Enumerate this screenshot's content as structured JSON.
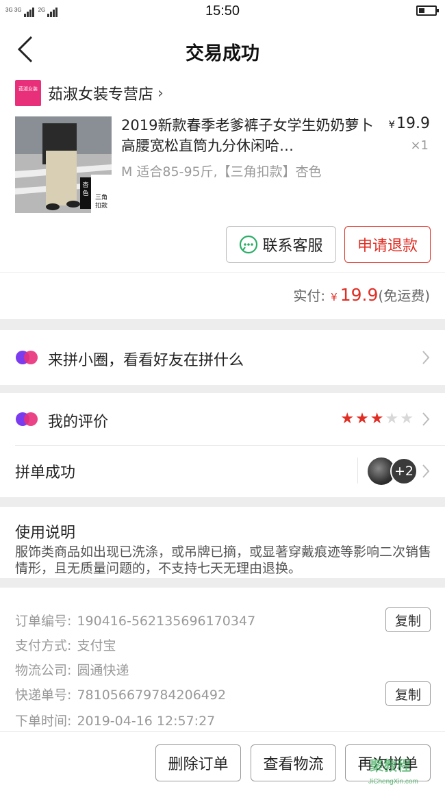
{
  "status_bar": {
    "time": "15:50",
    "signal_1": "3G 3G",
    "signal_2": "2G"
  },
  "header": {
    "title": "交易成功"
  },
  "order": {
    "shop": {
      "logo_text": "茹淑女装",
      "name": "茹淑女装专营店",
      "arrow": "›"
    },
    "product": {
      "image_tag_black": "杏色",
      "image_tag_white": "三角扣款",
      "title": "2019新款春季老爹裤子女学生奶奶萝卜高腰宽松直筒九分休闲哈…",
      "spec": "M 适合85-95斤,【三角扣款】杏色",
      "price_symbol": "¥",
      "price": "19.9",
      "quantity": "×1"
    },
    "buttons": {
      "contact_service": "联系客服",
      "request_refund": "申请退款"
    },
    "payment": {
      "label": "实付:",
      "symbol": "¥",
      "amount": "19.9",
      "note": "(免运费)"
    }
  },
  "circle": {
    "text": "来拼小圈，看看好友在拼什么"
  },
  "review": {
    "label": "我的评价",
    "rating": 3,
    "max_rating": 5
  },
  "group": {
    "label": "拼单成功",
    "more_count": "+2"
  },
  "usage": {
    "title": "使用说明",
    "body": "服饰类商品如出现已洗涤，或吊牌已摘，或显著穿戴痕迹等影响二次销售情形，且无质量问题的，不支持七天无理由退换。"
  },
  "info": {
    "order_no_label": "订单编号:",
    "order_no": "190416-562135696170347",
    "pay_method_label": "支付方式:",
    "pay_method": "支付宝",
    "logistics_label": "物流公司:",
    "logistics": "圆通快递",
    "tracking_label": "快递单号:",
    "tracking_no": "781056679784206492",
    "order_time_label": "下单时间:",
    "order_time": "2019-04-16 12:57:27",
    "copy_label": "复制"
  },
  "bottom": {
    "delete_order": "删除订单",
    "view_logistics": "查看物流",
    "regroup": "再次拼单"
  },
  "watermark": {
    "main": "聚教程",
    "sub": "JiChengXin.com"
  },
  "colors": {
    "accent_red": "#e02e24",
    "icon_pink": "#e8307a",
    "icon_purple": "#7b3cf0"
  }
}
